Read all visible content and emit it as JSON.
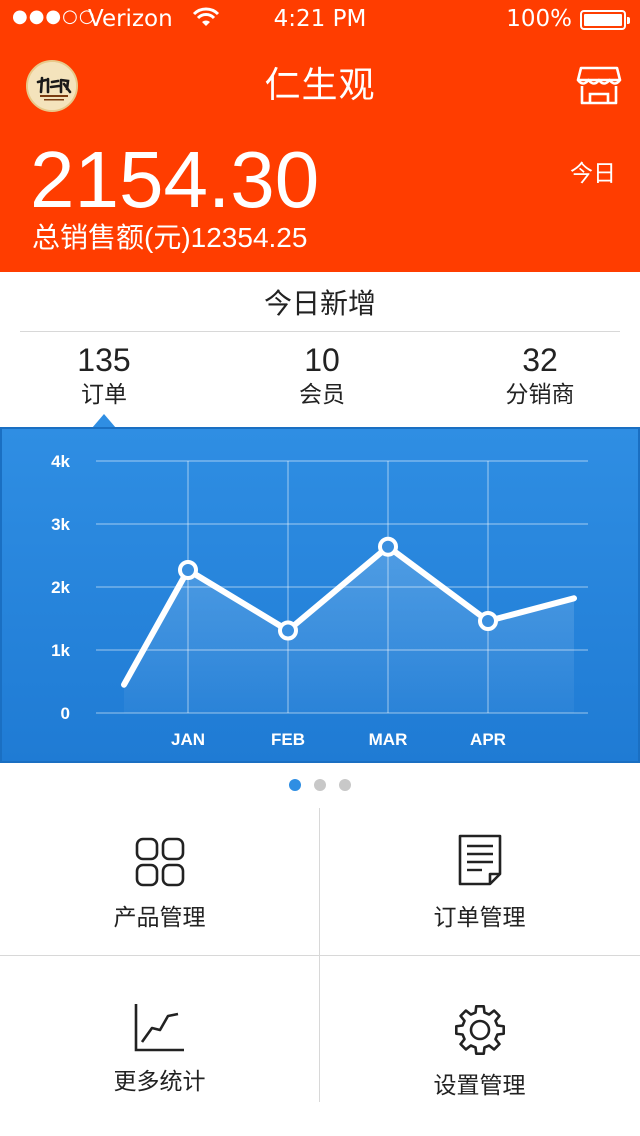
{
  "status_bar": {
    "signal": "●●●○○",
    "carrier": "Verizon",
    "time": "4:21 PM",
    "battery": "100%"
  },
  "nav": {
    "title": "仁生观"
  },
  "summary": {
    "today_amount": "2154.30",
    "today_label": "今日",
    "total_label": "总销售额(元)",
    "total_amount": "12354.25"
  },
  "today_new": {
    "title": "今日新增",
    "stats": [
      {
        "value": "135",
        "label": "订单"
      },
      {
        "value": "10",
        "label": "会员"
      },
      {
        "value": "32",
        "label": "分销商"
      }
    ]
  },
  "chart_data": {
    "type": "line",
    "categories": [
      "",
      "JAN",
      "FEB",
      "MAR",
      "APR",
      ""
    ],
    "values": [
      450,
      2270,
      1310,
      2640,
      1460,
      1820
    ],
    "y_ticks": [
      "0",
      "1k",
      "2k",
      "3k",
      "4k"
    ],
    "ylim": [
      0,
      4000
    ],
    "grid": true,
    "line_color": "#ffffff",
    "background_color": "#2f8ee3"
  },
  "pager": {
    "count": 3,
    "active": 0
  },
  "menu": [
    {
      "label": "产品管理",
      "icon": "grid-icon"
    },
    {
      "label": "订单管理",
      "icon": "document-icon"
    },
    {
      "label": "更多统计",
      "icon": "line-chart-icon"
    },
    {
      "label": "设置管理",
      "icon": "gear-icon"
    }
  ],
  "colors": {
    "header_orange": "#ff3d00",
    "chart_blue": "#2f8ee3",
    "dot_active": "#2f8ee3",
    "dot_inactive": "#c8c8c8"
  }
}
